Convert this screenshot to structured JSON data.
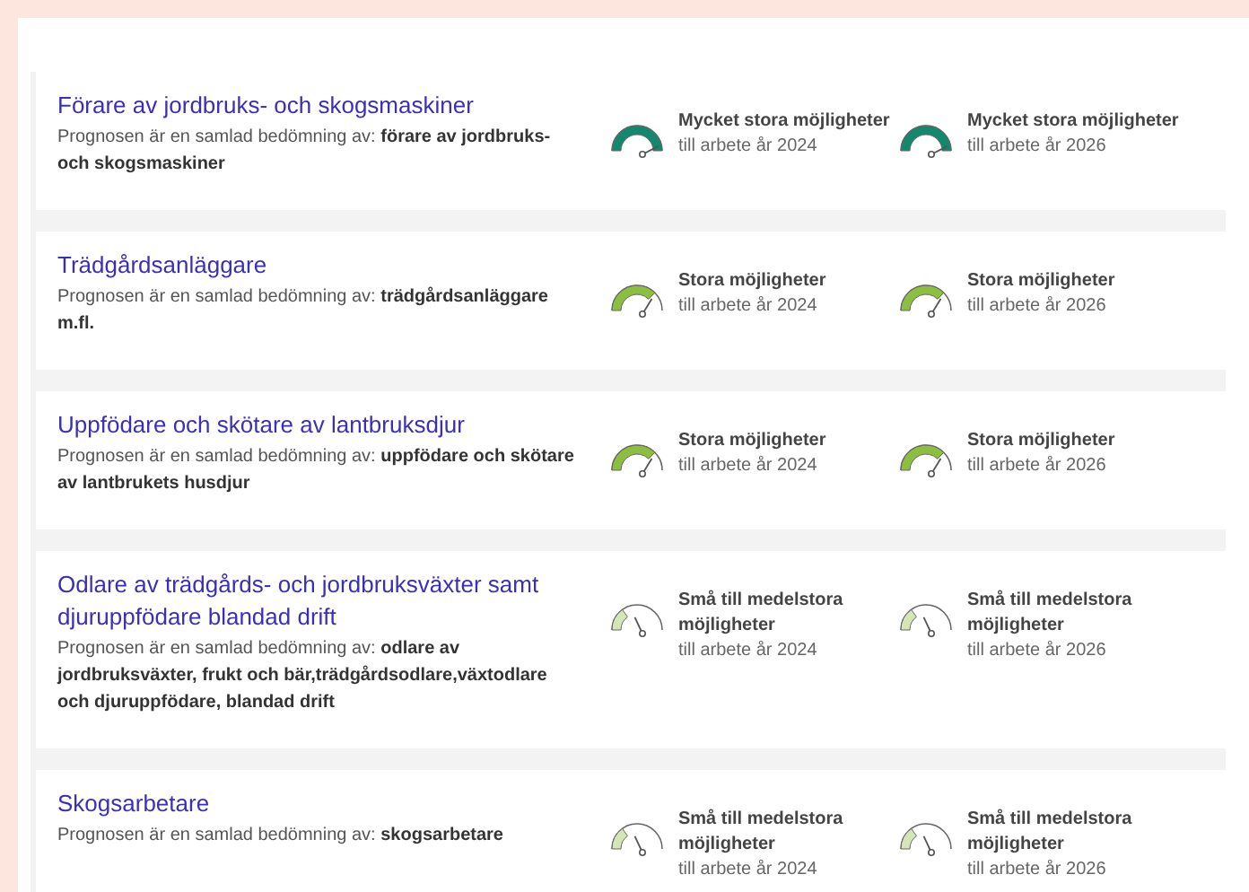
{
  "occupations": [
    {
      "title": "Förare av jordbruks- och skogsmaskiner",
      "description": "Prognosen är en samlad bedömning av: **förare av jordbruks- och skogsmaskiner**",
      "outlooks": [
        {
          "kind": "very_large",
          "label": "Mycket stora möjligheter",
          "period": "till arbete år 2024"
        },
        {
          "kind": "very_large",
          "label": "Mycket stora möjligheter",
          "period": "till arbete år 2026"
        }
      ]
    },
    {
      "title": "Trädgårdsanläggare",
      "description": "Prognosen är en samlad bedömning av: **trädgårdsanläggare m.fl.**",
      "outlooks": [
        {
          "kind": "large",
          "label": "Stora möjligheter",
          "period": "till arbete år 2024"
        },
        {
          "kind": "large",
          "label": "Stora möjligheter",
          "period": "till arbete år 2026"
        }
      ]
    },
    {
      "title": "Uppfödare och skötare av lantbruksdjur",
      "description": "Prognosen är en samlad bedömning av: **uppfödare och skötare av lantbrukets husdjur**",
      "outlooks": [
        {
          "kind": "large",
          "label": "Stora möjligheter",
          "period": "till arbete år 2024"
        },
        {
          "kind": "large",
          "label": "Stora möjligheter",
          "period": "till arbete år 2026"
        }
      ]
    },
    {
      "title": "Odlare av trädgårds- och jordbruksväxter samt djuruppfödare blandad drift",
      "description": "Prognosen är en samlad bedömning av: **odlare av jordbruksväxter, frukt och bär,trädgårdsodlare,växtodlare och djuruppfödare, blandad drift**",
      "outlooks": [
        {
          "kind": "small_medium",
          "label": "Små till medelstora möjligheter",
          "period": "till arbete år 2024"
        },
        {
          "kind": "small_medium",
          "label": "Små till medelstora möjligheter",
          "period": "till arbete år 2026"
        }
      ]
    },
    {
      "title": "Skogsarbetare",
      "description": "Prognosen är en samlad bedömning av: **skogsarbetare**",
      "outlooks": [
        {
          "kind": "small_medium",
          "label": "Små till medelstora möjligheter",
          "period": "till arbete år 2024"
        },
        {
          "kind": "small_medium",
          "label": "Små till medelstora möjligheter",
          "period": "till arbete år 2026"
        }
      ]
    }
  ]
}
